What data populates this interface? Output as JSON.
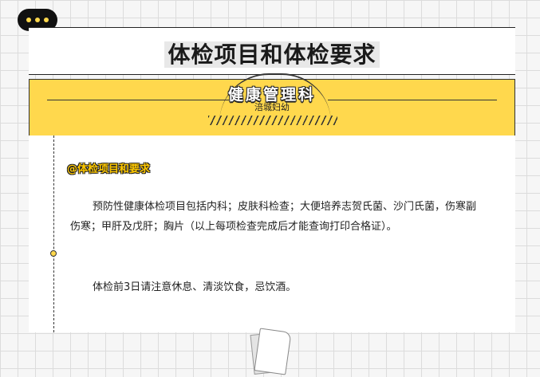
{
  "header": {
    "title": "体检项目和体检要求"
  },
  "banner": {
    "title": "健康管理科",
    "subtitle": "涪城妇幼"
  },
  "section": {
    "heading": "@体检项目和要求",
    "paragraphs": [
      "预防性健康体检项目包括内科；皮肤科检查；大便培养志贺氏菌、沙门氏菌，伤寒副伤寒；甲肝及戊肝；胸片（以上每项检查完成后才能查询打印合格证）。",
      "体检前3日请注意休息、清淡饮食，忌饮酒。"
    ]
  },
  "colors": {
    "accent": "#ffd84d",
    "ink": "#222222"
  },
  "icons": {
    "chat": "chat-bubble-icon",
    "paper": "paper-sheet-icon"
  }
}
